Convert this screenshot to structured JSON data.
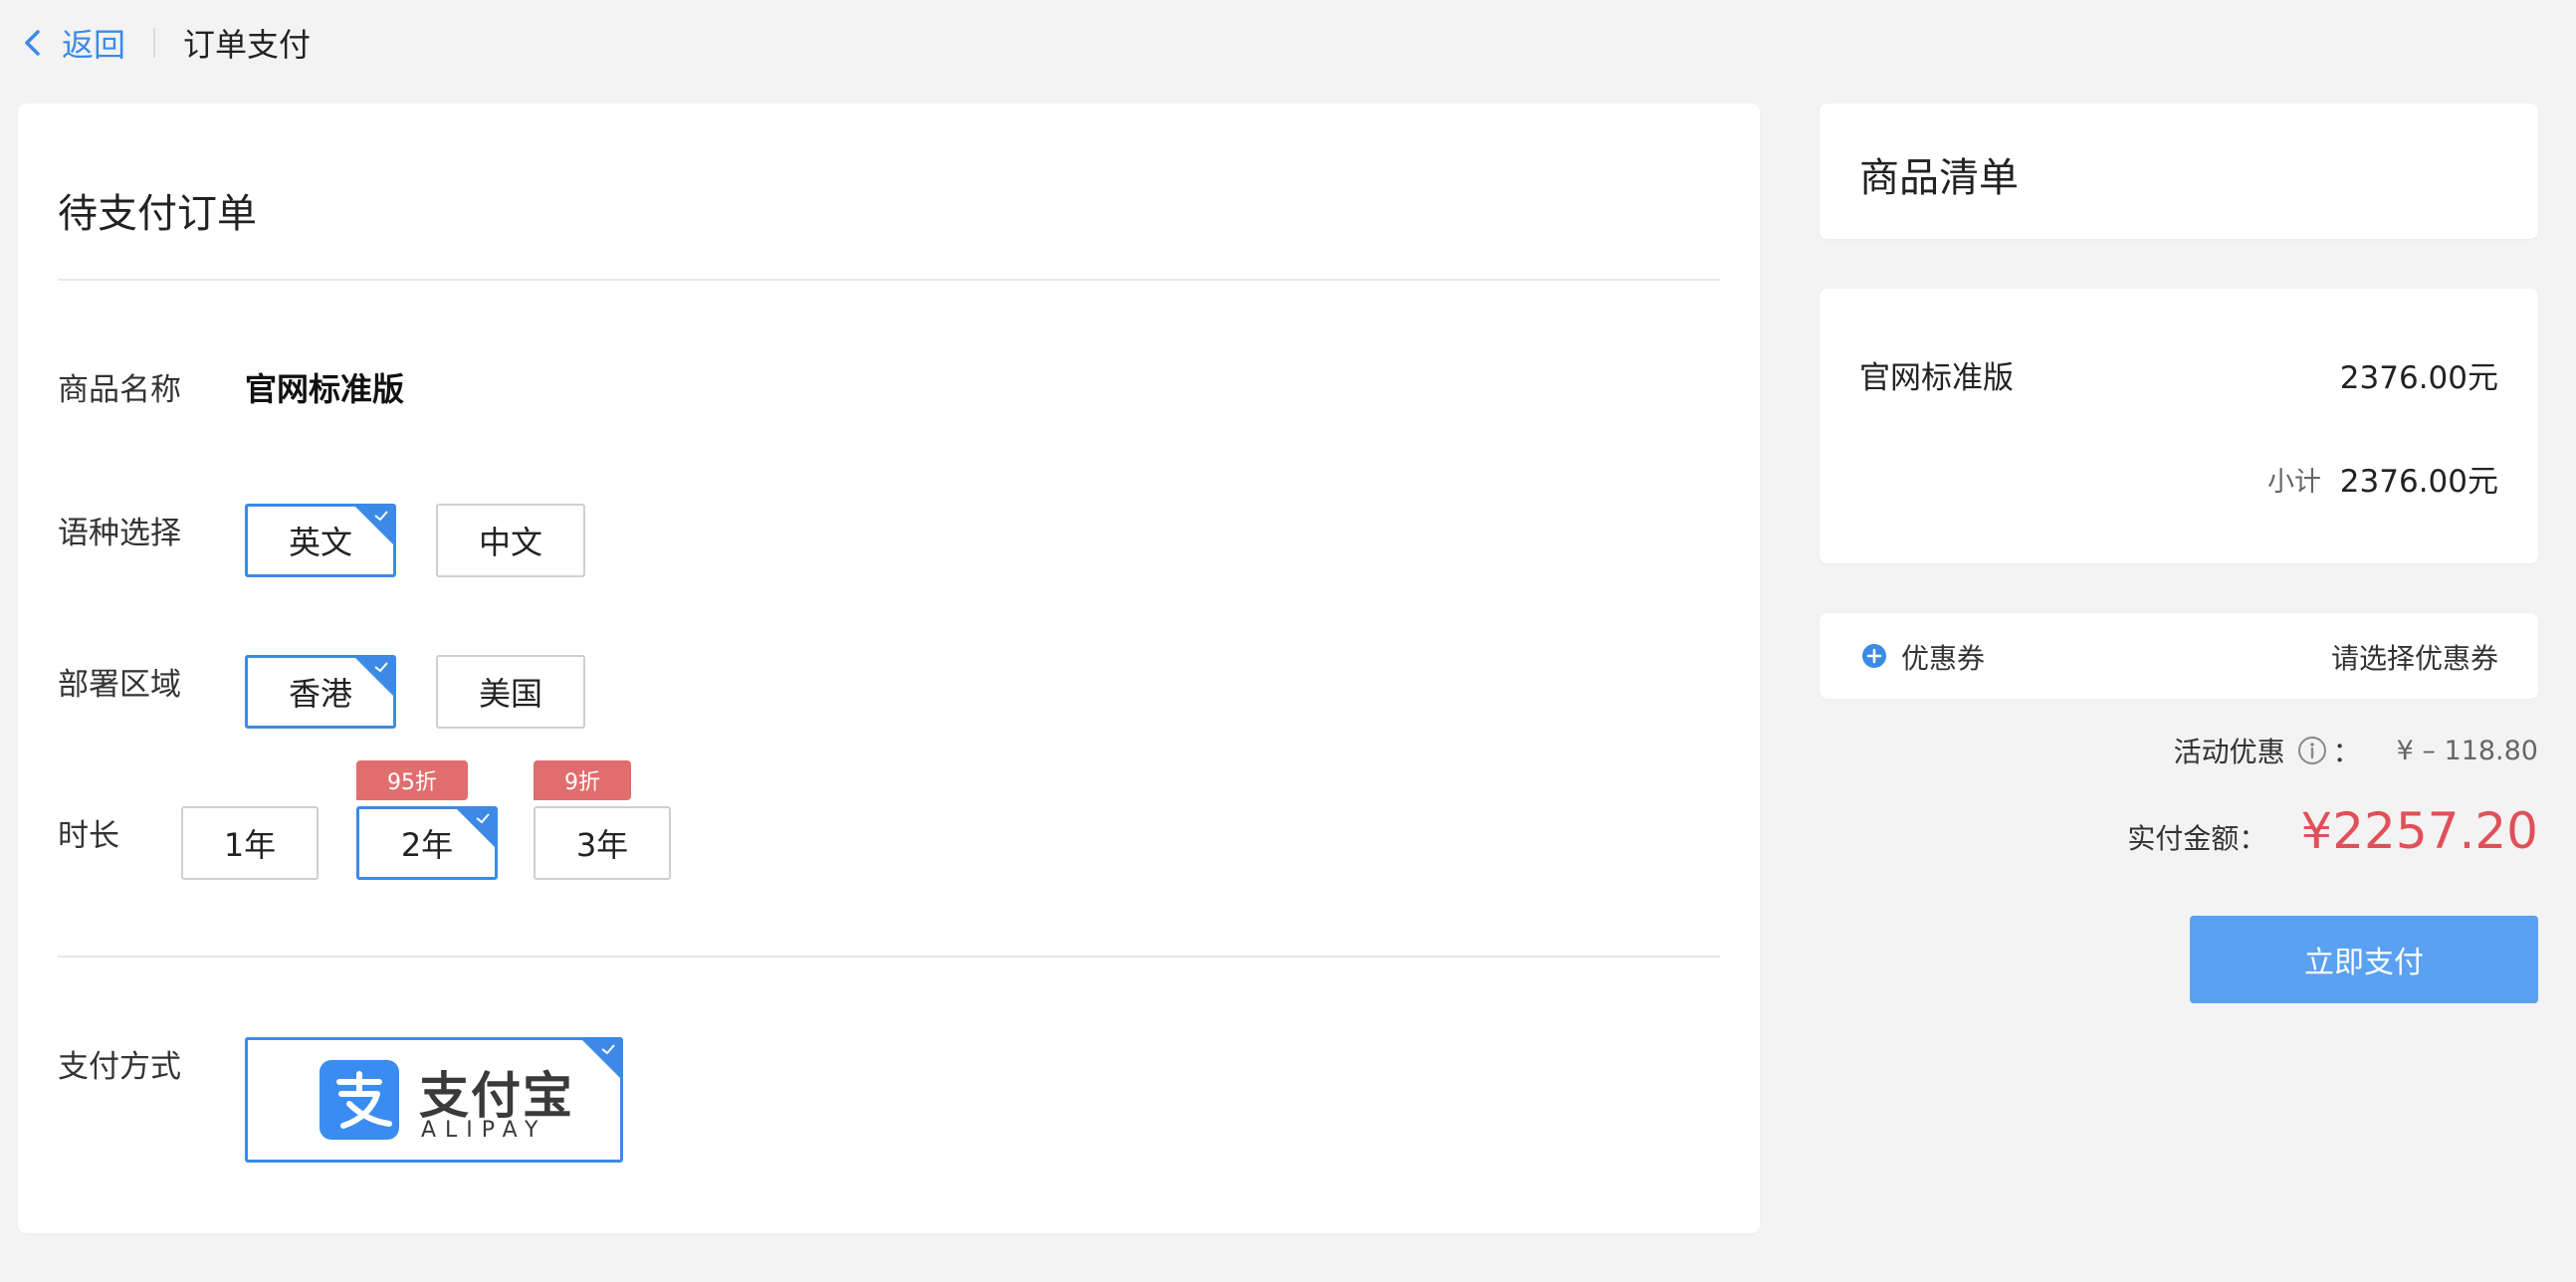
{
  "header": {
    "back_label": "返回",
    "breadcrumb": "订单支付"
  },
  "order": {
    "title": "待支付订单",
    "product_label": "商品名称",
    "product_name": "官网标准版",
    "language": {
      "label": "语种选择",
      "options": [
        "英文",
        "中文"
      ],
      "selected": "英文"
    },
    "region": {
      "label": "部署区域",
      "options": [
        "香港",
        "美国"
      ],
      "selected": "香港"
    },
    "duration": {
      "label": "时长",
      "options": [
        "1年",
        "2年",
        "3年"
      ],
      "selected": "2年",
      "badges": [
        "",
        "95折",
        "9折"
      ]
    },
    "payment": {
      "label": "支付方式",
      "method_cn": "支付宝",
      "method_en": "ALIPAY"
    }
  },
  "summary": {
    "title": "商品清单",
    "item_name": "官网标准版",
    "item_price": "2376.00元",
    "subtotal_label": "小计",
    "subtotal_value": "2376.00元",
    "coupon_label": "优惠券",
    "coupon_select": "请选择优惠券",
    "promo_label": "活动优惠",
    "promo_colon": "：",
    "promo_value": "¥ – 118.80",
    "total_label": "实付金额：",
    "total_value": "¥2257.20",
    "pay_button": "立即支付"
  },
  "colors": {
    "accent": "#3c8ae6",
    "badge": "#e06e6e",
    "total": "#e0505a",
    "pay_button": "#5aa1f2"
  }
}
